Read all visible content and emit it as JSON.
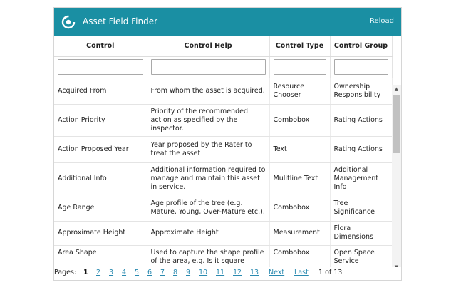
{
  "header": {
    "title": "Asset Field Finder",
    "reload_label": "Reload",
    "bg_color": "#1a8fa3",
    "logo_icon": "refresh-logo-icon"
  },
  "table": {
    "columns": [
      "Control",
      "Control Help",
      "Control Type",
      "Control Group"
    ],
    "filters": [
      "",
      "",
      "",
      ""
    ],
    "rows": [
      {
        "control": "Acquired From",
        "help": "From whom the asset is acquired.",
        "type": "Resource Chooser",
        "group": "Ownership Responsibility"
      },
      {
        "control": "Action Priority",
        "help": "Priority of the recommended action as specified by the inspector.",
        "type": "Combobox",
        "group": "Rating Actions"
      },
      {
        "control": "Action Proposed Year",
        "help": "Year proposed by the Rater to treat the asset",
        "type": "Text",
        "group": "Rating Actions"
      },
      {
        "control": "Additional Info",
        "help": "Additional information required to manage and maintain this asset in service.",
        "type": "Mulitline Text",
        "group": "Additional Management Info"
      },
      {
        "control": "Age Range",
        "help": "Age profile of the tree (e.g. Mature, Young, Over-Mature etc.).",
        "type": "Combobox",
        "group": "Tree Significance"
      },
      {
        "control": "Approximate Height",
        "help": "Approximate Height",
        "type": "Measurement",
        "group": "Flora Dimensions"
      },
      {
        "control": "Area Shape",
        "help": "Used to capture the shape profile of the area, e.g. Is it square",
        "type": "Combobox",
        "group": "Open Space Service"
      }
    ]
  },
  "pager": {
    "label": "Pages:",
    "current": "1",
    "pages": [
      "2",
      "3",
      "4",
      "5",
      "6",
      "7",
      "8",
      "9",
      "10",
      "11",
      "12",
      "13"
    ],
    "next_label": "Next",
    "last_label": "Last",
    "summary": "1 of 13"
  }
}
